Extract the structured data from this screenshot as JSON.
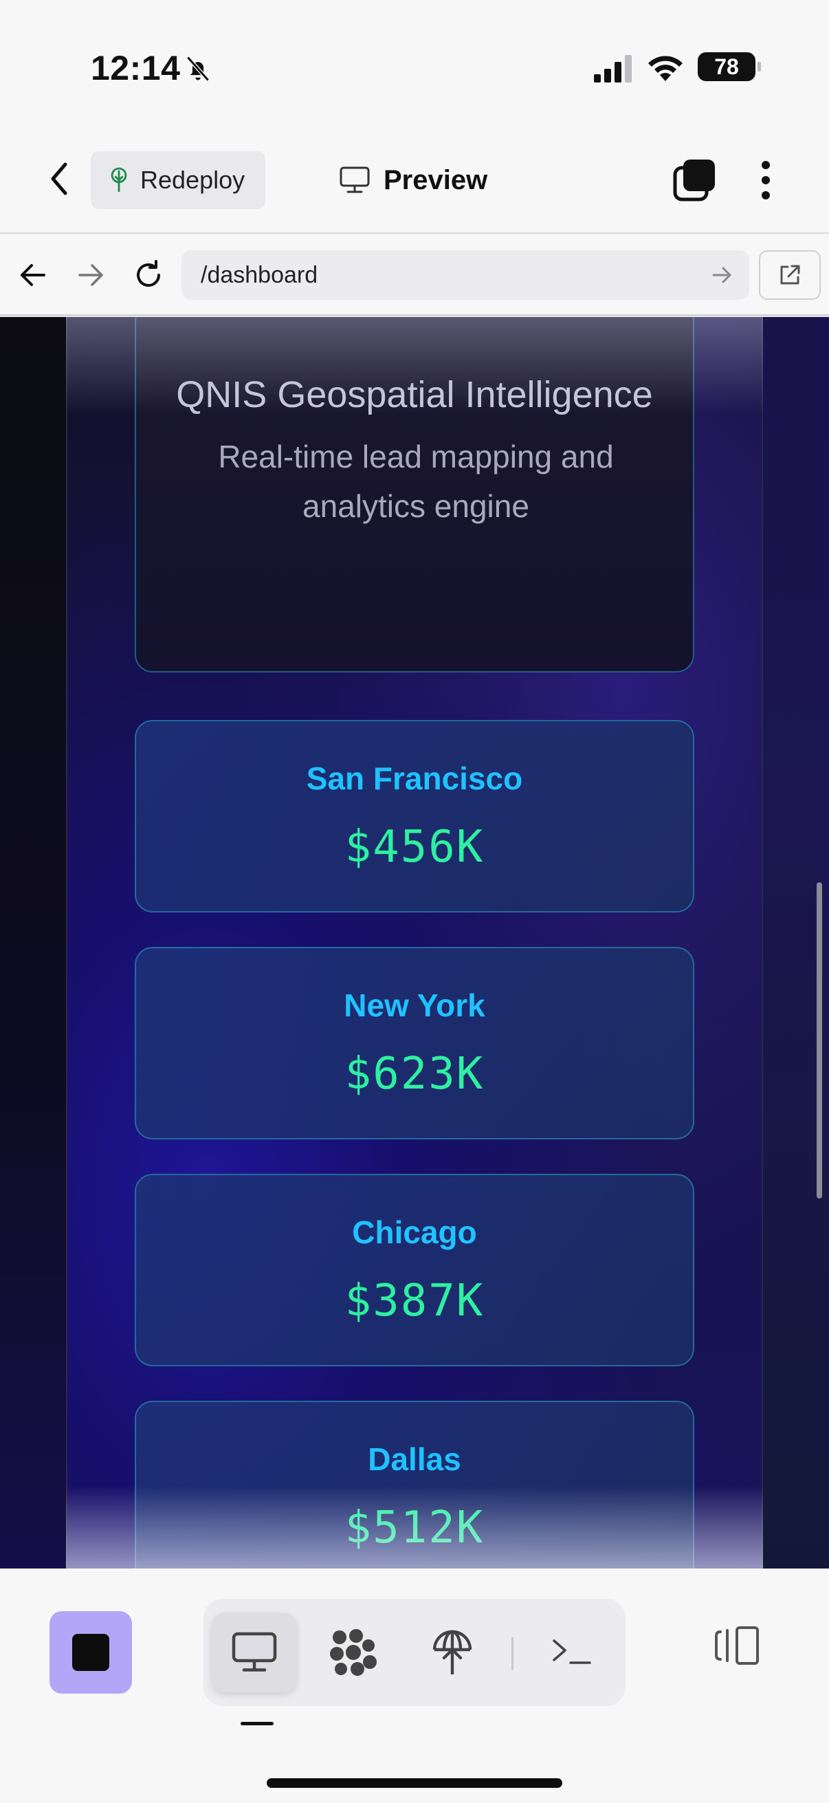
{
  "status_bar": {
    "time": "12:14",
    "battery": "78"
  },
  "header": {
    "redeploy_label": "Redeploy",
    "preview_label": "Preview"
  },
  "url_bar": {
    "path": "/dashboard"
  },
  "page": {
    "hero": {
      "title": "QNIS Geospatial Intelligence",
      "subtitle": "Real-time lead mapping and analytics engine"
    },
    "cities": [
      {
        "name": "San Francisco",
        "value": "$456K"
      },
      {
        "name": "New York",
        "value": "$623K"
      },
      {
        "name": "Chicago",
        "value": "$387K"
      },
      {
        "name": "Dallas",
        "value": "$512K"
      }
    ]
  },
  "colors": {
    "city_name": "#20c2ff",
    "city_value": "#2ef0a0",
    "stop_button": "#b3a6f7"
  }
}
